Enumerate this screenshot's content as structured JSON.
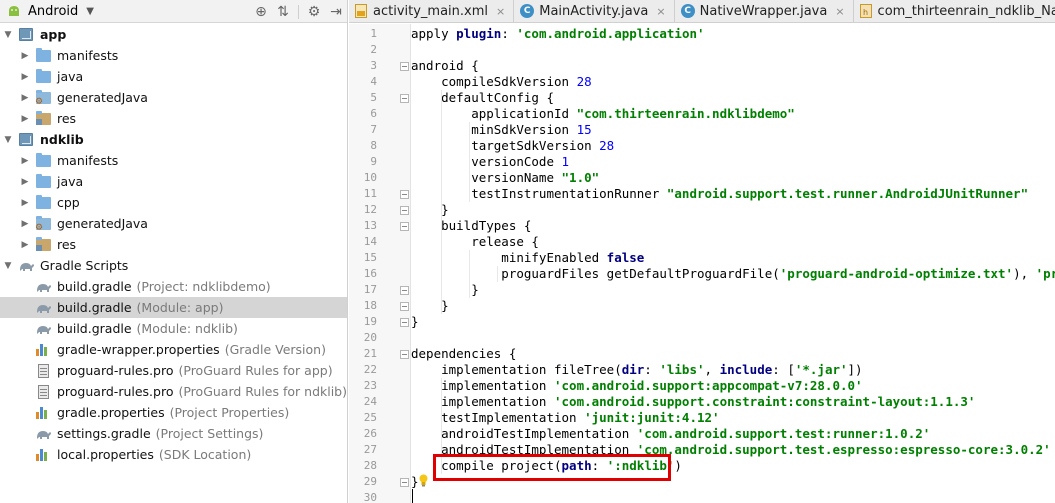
{
  "project_panel": {
    "view_title": "Android",
    "tree": [
      {
        "label": "app",
        "bold": true,
        "icon": "module-icon",
        "expanded": true,
        "depth": 0
      },
      {
        "label": "manifests",
        "icon": "folder-icon",
        "depth": 1
      },
      {
        "label": "java",
        "icon": "folder-icon",
        "depth": 1
      },
      {
        "label": "generatedJava",
        "icon": "generated-folder-icon",
        "depth": 1
      },
      {
        "label": "res",
        "icon": "res-folder-icon",
        "depth": 1
      },
      {
        "label": "ndklib",
        "bold": true,
        "icon": "module-icon",
        "expanded": true,
        "depth": 0
      },
      {
        "label": "manifests",
        "icon": "folder-icon",
        "depth": 1
      },
      {
        "label": "java",
        "icon": "folder-icon",
        "depth": 1
      },
      {
        "label": "cpp",
        "icon": "folder-icon",
        "depth": 1
      },
      {
        "label": "generatedJava",
        "icon": "generated-folder-icon",
        "depth": 1
      },
      {
        "label": "res",
        "icon": "res-folder-icon",
        "depth": 1
      },
      {
        "label": "Gradle Scripts",
        "icon": "gradle-icon",
        "expanded": true,
        "depth": 0
      },
      {
        "label": "build.gradle",
        "sub": "(Project: ndklibdemo)",
        "icon": "gradle-icon",
        "depth": 1
      },
      {
        "label": "build.gradle",
        "sub": "(Module: app)",
        "icon": "gradle-icon",
        "depth": 1,
        "selected": true
      },
      {
        "label": "build.gradle",
        "sub": "(Module: ndklib)",
        "icon": "gradle-icon",
        "depth": 1
      },
      {
        "label": "gradle-wrapper.properties",
        "sub": "(Gradle Version)",
        "icon": "properties-icon",
        "depth": 1
      },
      {
        "label": "proguard-rules.pro",
        "sub": "(ProGuard Rules for app)",
        "icon": "file-icon",
        "depth": 1
      },
      {
        "label": "proguard-rules.pro",
        "sub": "(ProGuard Rules for ndklib)",
        "icon": "file-icon",
        "depth": 1
      },
      {
        "label": "gradle.properties",
        "sub": "(Project Properties)",
        "icon": "properties-icon",
        "depth": 1
      },
      {
        "label": "settings.gradle",
        "sub": "(Project Settings)",
        "icon": "gradle-icon",
        "depth": 1
      },
      {
        "label": "local.properties",
        "sub": "(SDK Location)",
        "icon": "properties-icon",
        "depth": 1
      }
    ]
  },
  "editor": {
    "tabs": [
      {
        "label": "activity_main.xml",
        "icon": "xml-file-icon",
        "close": "×"
      },
      {
        "label": "MainActivity.java",
        "icon": "java-class-icon",
        "close": "×"
      },
      {
        "label": "NativeWrapper.java",
        "icon": "java-class-icon",
        "close": "×"
      },
      {
        "label": "com_thirteenrain_ndklib_NativeWrapper.h",
        "icon": "header-file-icon",
        "close": ""
      }
    ],
    "lines": [
      [
        [
          "t",
          "apply "
        ],
        [
          "k",
          "plugin"
        ],
        [
          "t",
          ": "
        ],
        [
          "s",
          "'com.android.application'"
        ]
      ],
      [],
      [
        [
          "t",
          "android {"
        ]
      ],
      [
        [
          "t",
          "    compileSdkVersion "
        ],
        [
          "n",
          "28"
        ]
      ],
      [
        [
          "t",
          "    defaultConfig {"
        ]
      ],
      [
        [
          "t",
          "        applicationId "
        ],
        [
          "s",
          "\"com.thirteenrain.ndklibdemo\""
        ]
      ],
      [
        [
          "t",
          "        minSdkVersion "
        ],
        [
          "n",
          "15"
        ]
      ],
      [
        [
          "t",
          "        targetSdkVersion "
        ],
        [
          "n",
          "28"
        ]
      ],
      [
        [
          "t",
          "        versionCode "
        ],
        [
          "n",
          "1"
        ]
      ],
      [
        [
          "t",
          "        versionName "
        ],
        [
          "s",
          "\"1.0\""
        ]
      ],
      [
        [
          "t",
          "        testInstrumentationRunner "
        ],
        [
          "s",
          "\"android.support.test.runner.AndroidJUnitRunner\""
        ]
      ],
      [
        [
          "t",
          "    }"
        ]
      ],
      [
        [
          "t",
          "    buildTypes {"
        ]
      ],
      [
        [
          "t",
          "        release {"
        ]
      ],
      [
        [
          "t",
          "            minifyEnabled "
        ],
        [
          "k",
          "false"
        ]
      ],
      [
        [
          "t",
          "            proguardFiles getDefaultProguardFile("
        ],
        [
          "s",
          "'proguard-android-optimize.txt'"
        ],
        [
          "t",
          "), "
        ],
        [
          "s",
          "'proguard"
        ]
      ],
      [
        [
          "t",
          "        }"
        ]
      ],
      [
        [
          "t",
          "    }"
        ]
      ],
      [
        [
          "t",
          "}"
        ]
      ],
      [],
      [
        [
          "t",
          "dependencies {"
        ]
      ],
      [
        [
          "t",
          "    implementation fileTree("
        ],
        [
          "k",
          "dir"
        ],
        [
          "t",
          ": "
        ],
        [
          "s",
          "'libs'"
        ],
        [
          "t",
          ", "
        ],
        [
          "k",
          "include"
        ],
        [
          "t",
          ": ["
        ],
        [
          "s",
          "'*.jar'"
        ],
        [
          "t",
          "])"
        ]
      ],
      [
        [
          "t",
          "    implementation "
        ],
        [
          "s",
          "'com.android.support:appcompat-v7:28.0.0'"
        ]
      ],
      [
        [
          "t",
          "    implementation "
        ],
        [
          "s",
          "'com.android.support.constraint:constraint-layout:1.1.3'"
        ]
      ],
      [
        [
          "t",
          "    testImplementation "
        ],
        [
          "s",
          "'junit:junit:4.12'"
        ]
      ],
      [
        [
          "t",
          "    androidTestImplementation "
        ],
        [
          "s",
          "'com.android.support.test:runner:1.0.2'"
        ]
      ],
      [
        [
          "t",
          "    androidTestImplementation "
        ],
        [
          "s",
          "'com.android.support.test.espresso:espresso-core:3.0.2'"
        ]
      ],
      [
        [
          "t",
          "    compile project("
        ],
        [
          "k",
          "path"
        ],
        [
          "t",
          ": "
        ],
        [
          "s",
          "':ndklib'"
        ],
        [
          "t",
          ")"
        ]
      ],
      [
        [
          "t",
          "}"
        ]
      ],
      []
    ],
    "fold_lines": [
      3,
      5,
      11,
      12,
      13,
      17,
      18,
      19,
      21,
      29
    ],
    "highlight_color": "#e00000"
  }
}
